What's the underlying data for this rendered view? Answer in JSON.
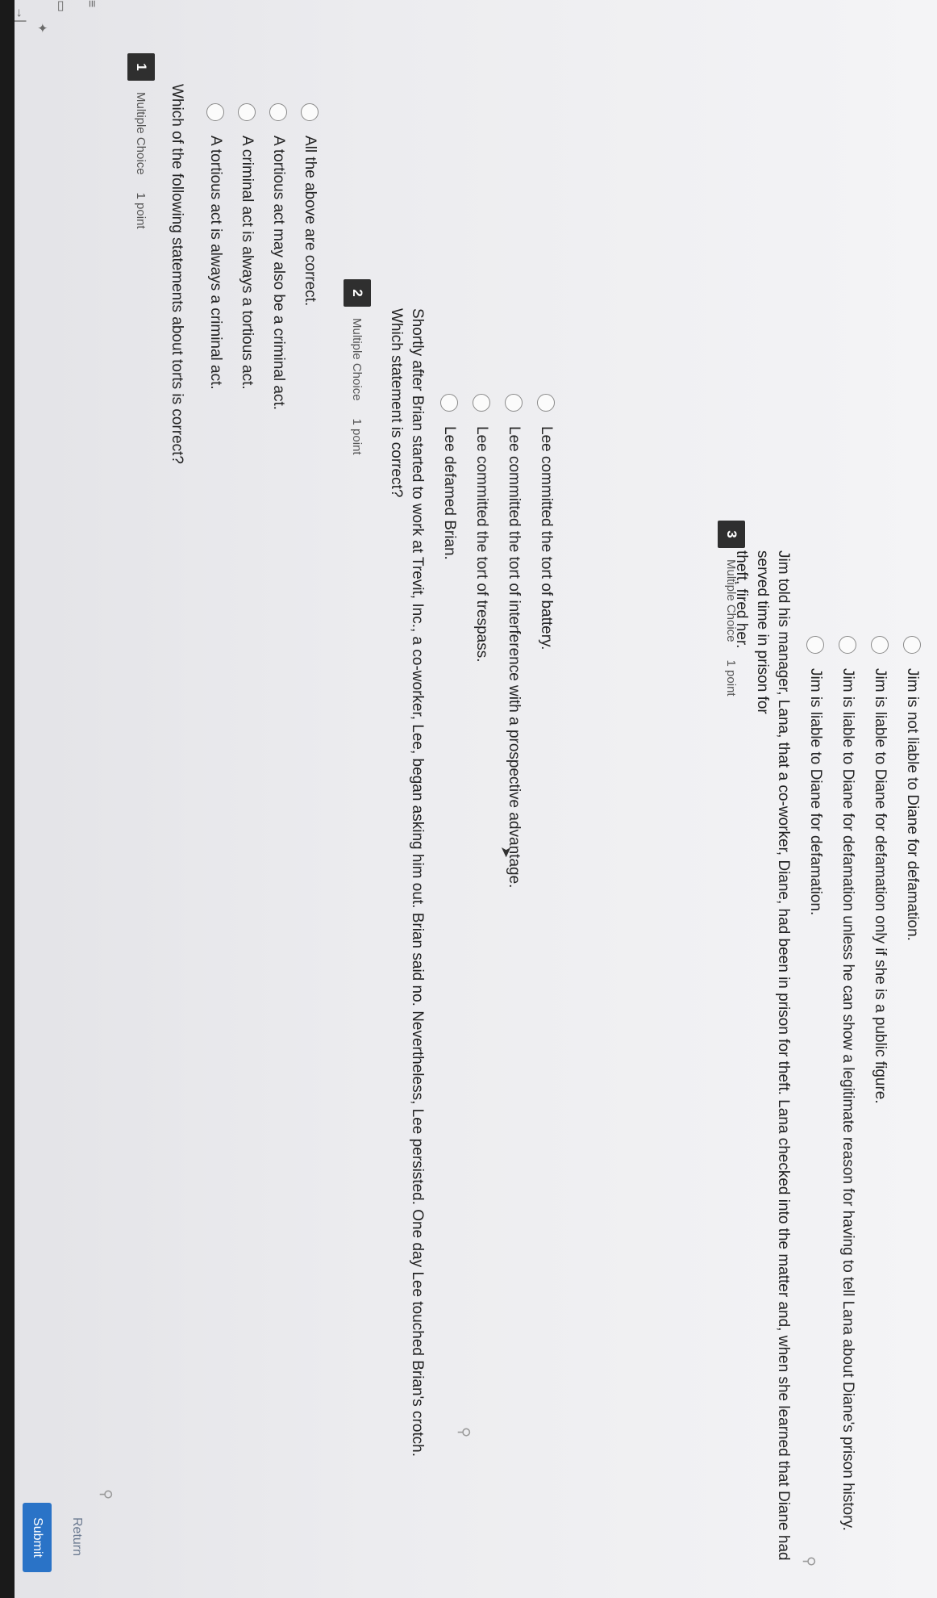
{
  "toolbar": {
    "submit_label": "Submit",
    "return_label": "Return"
  },
  "questions": [
    {
      "number": "1",
      "type": "Multiple Choice",
      "points": "1 point",
      "text_lines": [
        "Which of the following statements about torts is correct?"
      ],
      "options": [
        "A tortious act is always a criminal act.",
        "A criminal act is always a tortious act.",
        "A tortious act may also be a criminal act.",
        "All the above are correct."
      ]
    },
    {
      "number": "2",
      "type": "Multiple Choice",
      "points": "1 point",
      "text_lines": [
        "Shortly after Brian started to work at Trevit, Inc., a co-worker, Lee, began asking him out. Brian said no. Nevertheless, Lee persisted. One day Lee touched Brian's crotch.",
        "Which statement is correct?"
      ],
      "options": [
        "Lee defamed Brian.",
        "Lee committed the tort of trespass.",
        "Lee committed the tort of interference with a prospective advantage.",
        "Lee committed the tort of battery."
      ]
    },
    {
      "number": "3",
      "type": "Multiple Choice",
      "points": "1 point",
      "text_lines": [
        "Jim told his manager, Lana, that a co-worker, Diane, had been in prison for theft. Lana checked into the matter and, when she learned that Diane had served time in prison for",
        "theft, fired her."
      ],
      "options": [
        "Jim is liable to Diane for defamation.",
        "Jim is liable to Diane for defamation unless he can show a legitimate reason for having to tell Lana about Diane's prison history.",
        "Jim is liable to Diane for defamation only if she is a public figure.",
        "Jim is not liable to Diane for defamation."
      ]
    }
  ],
  "icons": {
    "flag": "pin-icon",
    "arrow": "arrow-right-icon"
  }
}
